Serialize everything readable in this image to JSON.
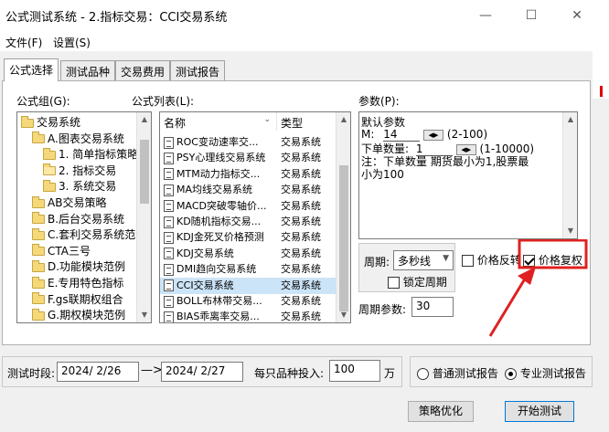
{
  "window": {
    "title": "公式测试系统 - 2.指标交易：CCI交易系统",
    "minimize_glyph": "—",
    "maximize_glyph": "☐",
    "close_glyph": "✕"
  },
  "menu": [
    "文件(F)",
    "设置(S)"
  ],
  "tabs": [
    "公式选择",
    "测试品种",
    "交易费用",
    "测试报告"
  ],
  "formula_group": {
    "label": "公式组(G):",
    "items": [
      {
        "text": "交易系统",
        "level": 0,
        "icon": "folder-icon"
      },
      {
        "text": "A.图表交易系统",
        "level": 1,
        "icon": "folder-icon"
      },
      {
        "text": "1. 简单指标策略",
        "level": 2,
        "icon": "folder-icon"
      },
      {
        "text": "2. 指标交易",
        "level": 2,
        "icon": "folder-open-icon"
      },
      {
        "text": "3. 系统交易",
        "level": 2,
        "icon": "folder-icon"
      },
      {
        "text": "AB交易策略",
        "level": 1,
        "icon": "folder-icon"
      },
      {
        "text": "B.后台交易系统",
        "level": 1,
        "icon": "folder-icon"
      },
      {
        "text": "C.套利交易系统范例",
        "level": 1,
        "icon": "folder-icon"
      },
      {
        "text": "CTA三号",
        "level": 1,
        "icon": "folder-icon"
      },
      {
        "text": "D.功能模块范例",
        "level": 1,
        "icon": "folder-icon"
      },
      {
        "text": "E.专用特色指标",
        "level": 1,
        "icon": "folder-icon"
      },
      {
        "text": "F.gs联期权组合",
        "level": 1,
        "icon": "folder-icon"
      },
      {
        "text": "G.期权模块范例",
        "level": 1,
        "icon": "folder-icon"
      }
    ]
  },
  "formula_list": {
    "label": "公式列表(L):",
    "col_name": "名称",
    "col_type": "类型",
    "rows": [
      {
        "name": "ROC变动速率交...",
        "type": "交易系统"
      },
      {
        "name": "PSY心理线交易系统",
        "type": "交易系统"
      },
      {
        "name": "MTM动力指标交...",
        "type": "交易系统"
      },
      {
        "name": "MA均线交易系统",
        "type": "交易系统"
      },
      {
        "name": "MACD突破零轴价...",
        "type": "交易系统"
      },
      {
        "name": "KD随机指标交易...",
        "type": "交易系统"
      },
      {
        "name": "KDJ金死叉价格预测",
        "type": "交易系统"
      },
      {
        "name": "KDJ交易系统",
        "type": "交易系统"
      },
      {
        "name": "DMI趋向交易系统",
        "type": "交易系统"
      },
      {
        "name": "CCI交易系统",
        "type": "交易系统"
      },
      {
        "name": "BOLL布林带交易...",
        "type": "交易系统"
      },
      {
        "name": "BIAS乖离率交易...",
        "type": "交易系统"
      }
    ]
  },
  "params": {
    "label": "参数(P):",
    "line1": "默认参数",
    "m_label": "M:",
    "m_value": "14",
    "m_range": "(2-100)",
    "lots_label": "下单数量:",
    "lots_value": "1",
    "lots_range": "(1-10000)",
    "note_line1": "注：下单数量 期货最小为1,股票最",
    "note_line2": "小为100"
  },
  "period": {
    "label": "周期:",
    "value": "多秒线",
    "lock_label": "锁定周期",
    "price_reverse_label": "价格反转",
    "price_adjust_label": "价格复权",
    "param_label": "周期参数:",
    "param_value": "30"
  },
  "test_period": {
    "label": "测试时段:",
    "start": "2024/ 2/26",
    "arrow": "—>",
    "end": "2024/ 2/27",
    "invest_label": "每只品种投入:",
    "invest_value": "100",
    "unit": "万"
  },
  "report": {
    "normal": "普通测试报告",
    "pro": "专业测试报告"
  },
  "buttons": {
    "optimize": "策略优化",
    "start": "开始测试"
  },
  "colors": {
    "annotation": "#e02020",
    "selection": "#cce4f7"
  }
}
